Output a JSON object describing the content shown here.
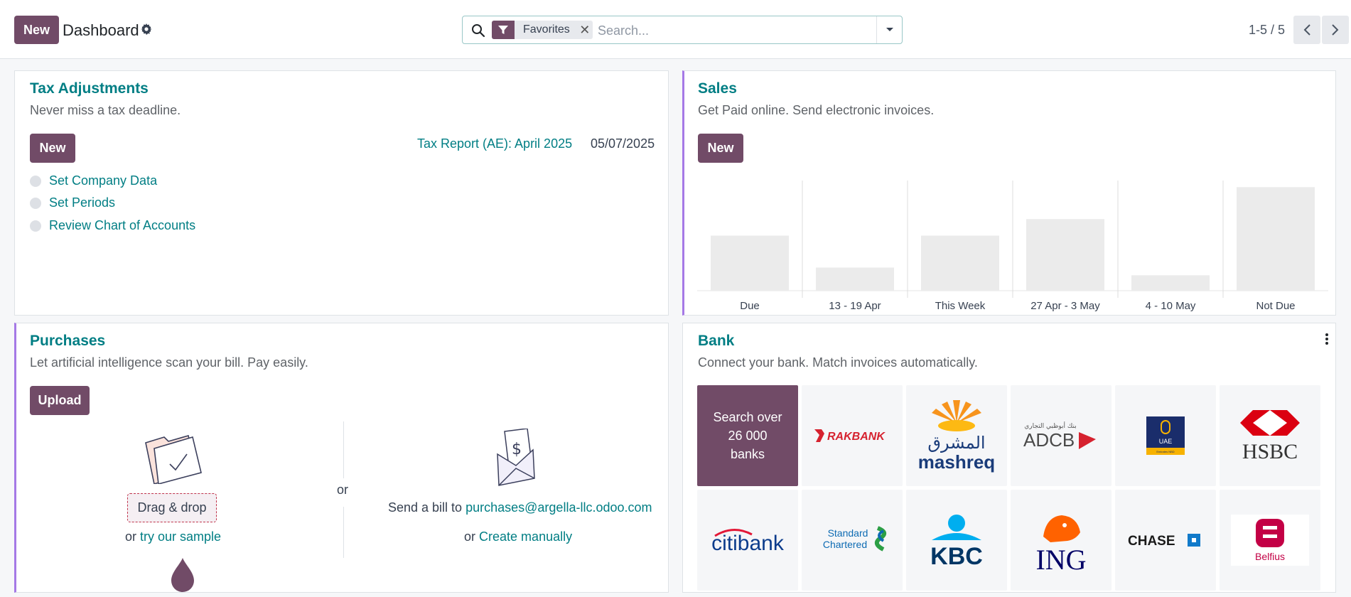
{
  "topbar": {
    "new_label": "New",
    "title": "Dashboard",
    "search": {
      "facet_label": "Favorites",
      "placeholder": "Search..."
    },
    "pager": "1-5 / 5"
  },
  "tax": {
    "title": "Tax Adjustments",
    "subtitle": "Never miss a tax deadline.",
    "new_label": "New",
    "report_link": "Tax Report (AE): April 2025",
    "report_date": "05/07/2025",
    "steps": [
      "Set Company Data",
      "Set Periods",
      "Review Chart of Accounts"
    ]
  },
  "sales": {
    "title": "Sales",
    "subtitle": "Get Paid online. Send electronic invoices.",
    "new_label": "New",
    "chart_data": {
      "type": "bar",
      "categories": [
        "Due",
        "13 - 19 Apr",
        "This Week",
        "27 Apr - 3 May",
        "4 - 10 May",
        "Not Due"
      ],
      "values": [
        50,
        21,
        50,
        65,
        14,
        94
      ],
      "ylim": [
        0,
        100
      ]
    }
  },
  "purchases": {
    "title": "Purchases",
    "subtitle": "Let artificial intelligence scan your bill. Pay easily.",
    "upload_label": "Upload",
    "drag_label": "Drag & drop",
    "or_text": "or",
    "try_sample": "try our sample",
    "send_text": "Send a bill to",
    "email": "purchases@argella-llc.odoo.com",
    "create_manually": "Create manually"
  },
  "bank": {
    "title": "Bank",
    "subtitle": "Connect your bank. Match invoices automatically.",
    "search_banks": "Search over 26 000 banks",
    "banks": [
      "RAKBANK",
      "mashreq",
      "ADCB",
      "UAE",
      "HSBC",
      "citibank",
      "Standard Chartered",
      "KBC",
      "ING",
      "CHASE",
      "Belfius"
    ],
    "bank_texts": {
      "mashreq_ar": "المشرق",
      "adcb_ar": "بنك أبوظبي التجاري",
      "uae_small": "Emirates NBD",
      "standard": "Standard",
      "chartered": "Chartered"
    }
  },
  "colors": {
    "primary": "#714b67",
    "link": "#017e84",
    "accent": "#a579e6"
  }
}
